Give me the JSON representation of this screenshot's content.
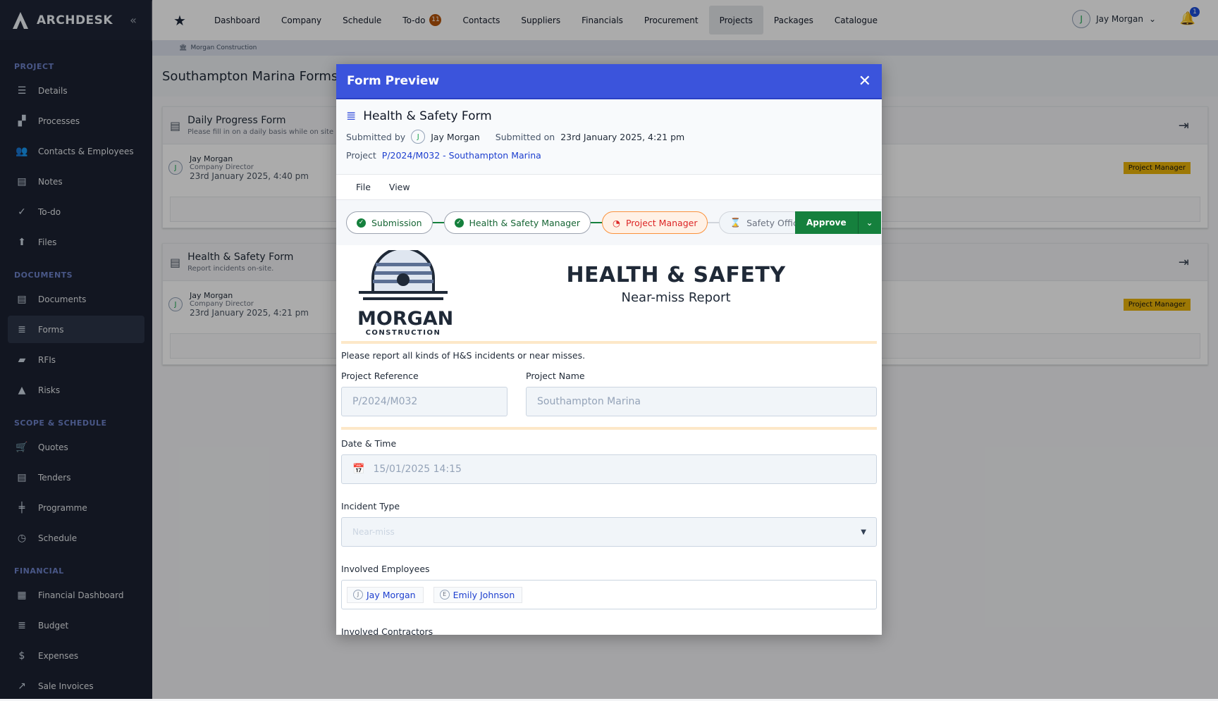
{
  "app": {
    "name": "ARCHDESK",
    "collapse_icon": "double-chevron-left-icon"
  },
  "sidebar": {
    "sections": [
      {
        "title": "PROJECT",
        "items": [
          {
            "label": "Details",
            "icon": "☰"
          },
          {
            "label": "Processes",
            "icon": "▞"
          },
          {
            "label": "Contacts & Employees",
            "icon": "👥"
          },
          {
            "label": "Notes",
            "icon": "▤"
          },
          {
            "label": "To-do",
            "icon": "✓"
          },
          {
            "label": "Files",
            "icon": "⬆"
          }
        ]
      },
      {
        "title": "DOCUMENTS",
        "items": [
          {
            "label": "Documents",
            "icon": "▤"
          },
          {
            "label": "Forms",
            "icon": "≣",
            "active": true
          },
          {
            "label": "RFIs",
            "icon": "▰"
          },
          {
            "label": "Risks",
            "icon": "▲"
          }
        ]
      },
      {
        "title": "SCOPE & SCHEDULE",
        "items": [
          {
            "label": "Quotes",
            "icon": "🛒"
          },
          {
            "label": "Tenders",
            "icon": "▤"
          },
          {
            "label": "Programme",
            "icon": "╪"
          },
          {
            "label": "Schedule",
            "icon": "◷"
          }
        ]
      },
      {
        "title": "FINANCIAL",
        "items": [
          {
            "label": "Financial Dashboard",
            "icon": "▦"
          },
          {
            "label": "Budget",
            "icon": "≣"
          },
          {
            "label": "Expenses",
            "icon": "$"
          },
          {
            "label": "Sale Invoices",
            "icon": "↗"
          }
        ]
      }
    ]
  },
  "topnav": {
    "items": [
      "Dashboard",
      "Company",
      "Schedule",
      "To-do",
      "Contacts",
      "Suppliers",
      "Financials",
      "Procurement",
      "Projects",
      "Packages",
      "Catalogue"
    ],
    "active": "Projects",
    "todo_count": "11",
    "user": {
      "initial": "J",
      "name": "Jay Morgan"
    },
    "notifications": "1"
  },
  "breadcrumb": "Morgan Construction",
  "page": {
    "title": "Southampton Marina Forms",
    "cards": [
      {
        "title": "Daily Progress Form",
        "desc": "Please fill in on a daily basis while on site",
        "user": "Jay Morgan",
        "role": "Company Director",
        "date": "23rd January 2025, 4:40 pm",
        "badge": "Project Manager",
        "initial": "J"
      },
      {
        "title": "Health & Safety Form",
        "desc": "Report incidents on-site.",
        "user": "Jay Morgan",
        "role": "Company Director",
        "date": "23rd January 2025, 4:21 pm",
        "badge": "Project Manager",
        "initial": "J"
      }
    ]
  },
  "modal": {
    "title": "Form Preview",
    "form_title": "Health & Safety Form",
    "submitted_by_label": "Submitted by",
    "submitted_by": "Jay Morgan",
    "submitted_initial": "J",
    "submitted_on_label": "Submitted on",
    "submitted_on": "23rd January 2025, 4:21 pm",
    "project_label": "Project",
    "project": "P/2024/M032 - Southampton Marina",
    "menu": [
      "File",
      "View"
    ],
    "workflow": [
      {
        "label": "Submission",
        "state": "done"
      },
      {
        "label": "Health & Safety Manager",
        "state": "done"
      },
      {
        "label": "Project Manager",
        "state": "current"
      },
      {
        "label": "Safety Officer",
        "state": "pending"
      }
    ],
    "approve": "Approve",
    "form": {
      "logo_text": "MORGAN",
      "logo_sub": "CONSTRUCTION",
      "heading": "HEALTH & SAFETY",
      "subheading": "Near-miss Report",
      "intro": "Please report all kinds of H&S incidents or near misses.",
      "project_reference_label": "Project Reference",
      "project_reference": "P/2024/M032",
      "project_name_label": "Project Name",
      "project_name": "Southampton Marina",
      "datetime_label": "Date & Time",
      "datetime": "15/01/2025 14:15",
      "incident_type_label": "Incident Type",
      "incident_type": "Near-miss",
      "employees_label": "Involved Employees",
      "employees": [
        {
          "initial": "J",
          "name": "Jay Morgan"
        },
        {
          "initial": "E",
          "name": "Emily Johnson"
        }
      ],
      "contractors_label": "Involved Contractors"
    }
  },
  "colors": {
    "modal_header": "#3b54dc",
    "approve": "#15803d",
    "current_step": "#dc2626",
    "badge": "#eab308"
  }
}
